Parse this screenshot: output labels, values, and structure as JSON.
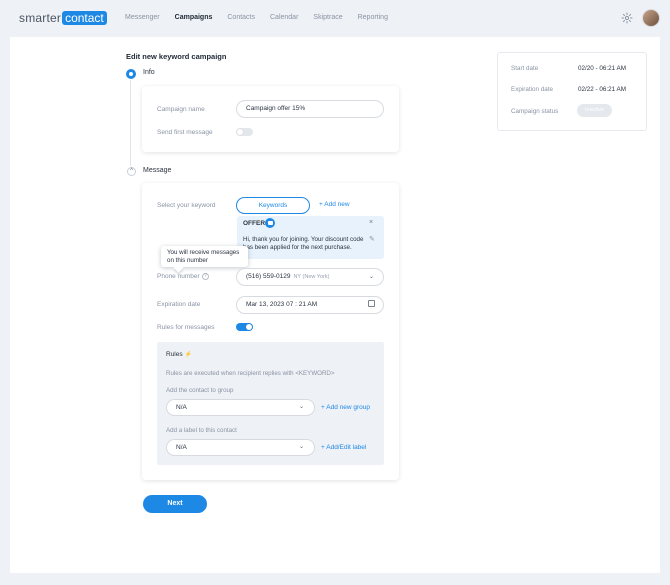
{
  "brand": {
    "logo_left": "smarter",
    "logo_right": "contact",
    "accent": "#1e88e5"
  },
  "nav": {
    "items": [
      "Messenger",
      "Campaigns",
      "Contacts",
      "Calendar",
      "Skiptrace",
      "Reporting"
    ],
    "active": "Campaigns"
  },
  "page": {
    "title": "Edit new keyword campaign"
  },
  "info_step": {
    "label": "Info",
    "campaign_name_label": "Campaign name",
    "campaign_name_value": "Campaign offer 15%",
    "send_first_label": "Send first message",
    "send_first_on": false
  },
  "message_step": {
    "label": "Message",
    "chevron": "^",
    "keyword_label": "Select your keyword",
    "keywords_button": "Keywords",
    "add_new": "+ Add new",
    "keyword_tag": "OFFER",
    "keyword_close": "×",
    "keyword_edit": "✎",
    "keyword_text": "Hi, thank you for joining. Your discount code has been applied for the next purchase.",
    "tooltip": "You will receive messages on this number",
    "phone_label": "Phone number",
    "phone_info": "?",
    "phone_value": "(516) 559-0129",
    "phone_location": "NY (New York)",
    "expiration_label": "Expiration date",
    "expiration_value": "Mar 13, 2023 07 : 21 AM",
    "rules_label": "Rules for messages",
    "rules_on": true
  },
  "rules": {
    "title": "Rules",
    "bolt": "⚡",
    "description": "Rules are executed when recipient replies with <KEYWORD>",
    "group_label": "Add the contact to group",
    "group_value": "N/A",
    "group_link": "+ Add new group",
    "label_label": "Add a label to this contact",
    "label_value": "N/A",
    "label_link": "+ Add/Edit label"
  },
  "next_button": "Next",
  "summary": {
    "start_label": "Start date",
    "start_value": "02/20 - 06:21 AM",
    "exp_label": "Expiration date",
    "exp_value": "02/22 - 06:21 AM",
    "status_label": "Campaign status",
    "status_value": "Inactive"
  },
  "icons": {
    "settings": "gear-icon",
    "calendar": "calendar-icon",
    "select": "chevron-down-icon"
  }
}
